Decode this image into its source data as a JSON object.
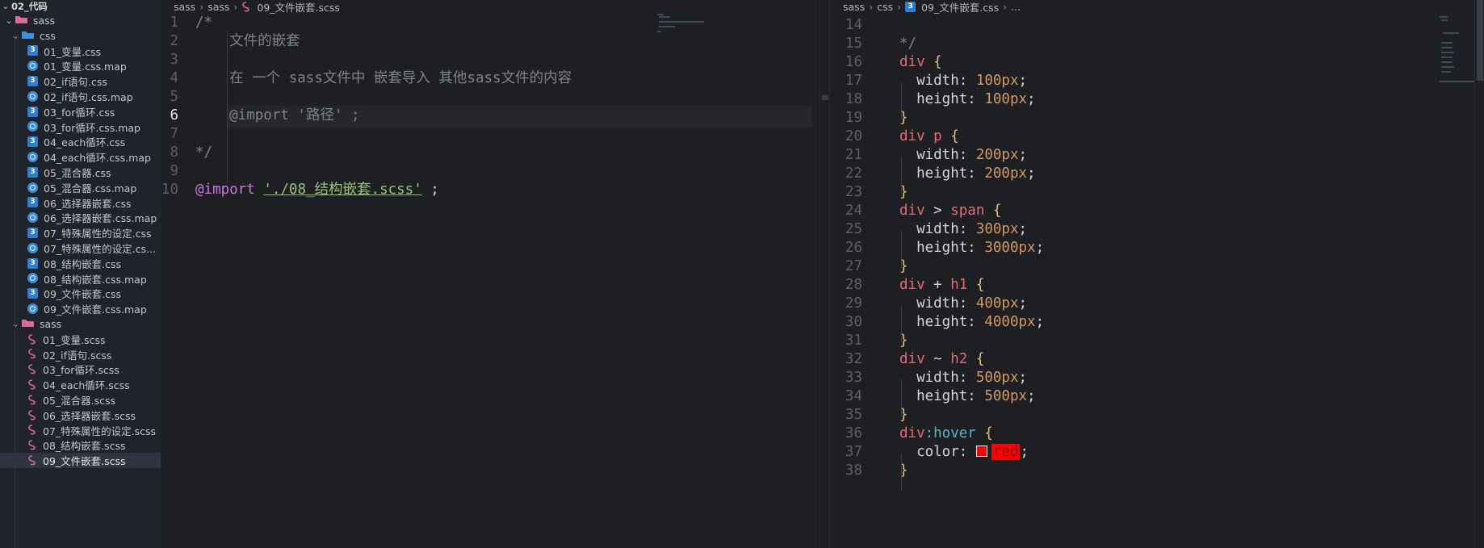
{
  "explorer": {
    "root": "02_代码",
    "items": [
      {
        "label": "sass",
        "type": "folder-sass",
        "depth": 0,
        "open": true
      },
      {
        "label": "css",
        "type": "folder-css",
        "depth": 1,
        "open": true
      },
      {
        "label": "01_变量.css",
        "type": "css",
        "depth": 2
      },
      {
        "label": "01_变量.css.map",
        "type": "map",
        "depth": 2
      },
      {
        "label": "02_if语句.css",
        "type": "css",
        "depth": 2
      },
      {
        "label": "02_if语句.css.map",
        "type": "map",
        "depth": 2
      },
      {
        "label": "03_for循环.css",
        "type": "css",
        "depth": 2
      },
      {
        "label": "03_for循环.css.map",
        "type": "map",
        "depth": 2
      },
      {
        "label": "04_each循环.css",
        "type": "css",
        "depth": 2
      },
      {
        "label": "04_each循环.css.map",
        "type": "map",
        "depth": 2
      },
      {
        "label": "05_混合器.css",
        "type": "css",
        "depth": 2
      },
      {
        "label": "05_混合器.css.map",
        "type": "map",
        "depth": 2
      },
      {
        "label": "06_选择器嵌套.css",
        "type": "css",
        "depth": 2
      },
      {
        "label": "06_选择器嵌套.css.map",
        "type": "map",
        "depth": 2
      },
      {
        "label": "07_特殊属性的设定.css",
        "type": "css",
        "depth": 2
      },
      {
        "label": "07_特殊属性的设定.cs...",
        "type": "map",
        "depth": 2
      },
      {
        "label": "08_结构嵌套.css",
        "type": "css",
        "depth": 2
      },
      {
        "label": "08_结构嵌套.css.map",
        "type": "map",
        "depth": 2
      },
      {
        "label": "09_文件嵌套.css",
        "type": "css",
        "depth": 2
      },
      {
        "label": "09_文件嵌套.css.map",
        "type": "map",
        "depth": 2
      },
      {
        "label": "sass",
        "type": "folder-sass",
        "depth": 1,
        "open": true
      },
      {
        "label": "01_变量.scss",
        "type": "scss",
        "depth": 2
      },
      {
        "label": "02_if语句.scss",
        "type": "scss",
        "depth": 2
      },
      {
        "label": "03_for循环.scss",
        "type": "scss",
        "depth": 2
      },
      {
        "label": "04_each循环.scss",
        "type": "scss",
        "depth": 2
      },
      {
        "label": "05_混合器.scss",
        "type": "scss",
        "depth": 2
      },
      {
        "label": "06_选择器嵌套.scss",
        "type": "scss",
        "depth": 2
      },
      {
        "label": "07_特殊属性的设定.scss",
        "type": "scss",
        "depth": 2
      },
      {
        "label": "08_结构嵌套.scss",
        "type": "scss",
        "depth": 2
      },
      {
        "label": "09_文件嵌套.scss",
        "type": "scss",
        "depth": 2,
        "active": true
      }
    ]
  },
  "left_editor": {
    "breadcrumb": [
      "sass",
      "sass",
      "09_文件嵌套.scss"
    ],
    "current_line": 6,
    "lines": [
      {
        "n": "1",
        "tokens": [
          [
            "cmt",
            "/*"
          ]
        ]
      },
      {
        "n": "2",
        "tokens": [
          [
            "cmt",
            "    文件的嵌套"
          ]
        ]
      },
      {
        "n": "3",
        "tokens": []
      },
      {
        "n": "4",
        "tokens": [
          [
            "cmt",
            "    在 一个 sass文件中 嵌套导入 其他sass文件的内容"
          ]
        ]
      },
      {
        "n": "5",
        "tokens": []
      },
      {
        "n": "6",
        "tokens": [
          [
            "cmt",
            "    @import '路径' ;"
          ]
        ]
      },
      {
        "n": "7",
        "tokens": []
      },
      {
        "n": "8",
        "tokens": [
          [
            "cmt",
            "*/"
          ]
        ]
      },
      {
        "n": "9",
        "tokens": []
      },
      {
        "n": "10",
        "tokens": [
          [
            "kw-at",
            "@import"
          ],
          [
            "punc",
            " "
          ],
          [
            "str",
            "'./08_结构嵌套.scss'"
          ],
          [
            "punc",
            " ;"
          ]
        ]
      }
    ]
  },
  "right_editor": {
    "breadcrumb": [
      "sass",
      "css",
      "09_文件嵌套.css",
      "..."
    ],
    "lines": [
      {
        "n": "14",
        "tokens": []
      },
      {
        "n": "15",
        "tokens": [
          [
            "cmt",
            "*/"
          ]
        ]
      },
      {
        "n": "16",
        "tokens": [
          [
            "sel",
            "div"
          ],
          [
            "punc",
            " "
          ],
          [
            "brace",
            "{"
          ]
        ]
      },
      {
        "n": "17",
        "tokens": [
          [
            "prop",
            "  width: "
          ],
          [
            "num",
            "100px"
          ],
          [
            "punc",
            ";"
          ]
        ]
      },
      {
        "n": "18",
        "tokens": [
          [
            "prop",
            "  height: "
          ],
          [
            "num",
            "100px"
          ],
          [
            "punc",
            ";"
          ]
        ]
      },
      {
        "n": "19",
        "tokens": [
          [
            "brace",
            "}"
          ]
        ]
      },
      {
        "n": "20",
        "tokens": [
          [
            "sel",
            "div p"
          ],
          [
            "punc",
            " "
          ],
          [
            "brace",
            "{"
          ]
        ]
      },
      {
        "n": "21",
        "tokens": [
          [
            "prop",
            "  width: "
          ],
          [
            "num",
            "200px"
          ],
          [
            "punc",
            ";"
          ]
        ]
      },
      {
        "n": "22",
        "tokens": [
          [
            "prop",
            "  height: "
          ],
          [
            "num",
            "200px"
          ],
          [
            "punc",
            ";"
          ]
        ]
      },
      {
        "n": "23",
        "tokens": [
          [
            "brace",
            "}"
          ]
        ]
      },
      {
        "n": "24",
        "tokens": [
          [
            "sel",
            "div"
          ],
          [
            "punc",
            " > "
          ],
          [
            "sel",
            "span"
          ],
          [
            "punc",
            " "
          ],
          [
            "brace",
            "{"
          ]
        ]
      },
      {
        "n": "25",
        "tokens": [
          [
            "prop",
            "  width: "
          ],
          [
            "num",
            "300px"
          ],
          [
            "punc",
            ";"
          ]
        ]
      },
      {
        "n": "26",
        "tokens": [
          [
            "prop",
            "  height: "
          ],
          [
            "num",
            "3000px"
          ],
          [
            "punc",
            ";"
          ]
        ]
      },
      {
        "n": "27",
        "tokens": [
          [
            "brace",
            "}"
          ]
        ]
      },
      {
        "n": "28",
        "tokens": [
          [
            "sel",
            "div"
          ],
          [
            "punc",
            " + "
          ],
          [
            "sel",
            "h1"
          ],
          [
            "punc",
            " "
          ],
          [
            "brace",
            "{"
          ]
        ]
      },
      {
        "n": "29",
        "tokens": [
          [
            "prop",
            "  width: "
          ],
          [
            "num",
            "400px"
          ],
          [
            "punc",
            ";"
          ]
        ]
      },
      {
        "n": "30",
        "tokens": [
          [
            "prop",
            "  height: "
          ],
          [
            "num",
            "4000px"
          ],
          [
            "punc",
            ";"
          ]
        ]
      },
      {
        "n": "31",
        "tokens": [
          [
            "brace",
            "}"
          ]
        ]
      },
      {
        "n": "32",
        "tokens": [
          [
            "sel",
            "div"
          ],
          [
            "punc",
            " ~ "
          ],
          [
            "sel",
            "h2"
          ],
          [
            "punc",
            " "
          ],
          [
            "brace",
            "{"
          ]
        ]
      },
      {
        "n": "33",
        "tokens": [
          [
            "prop",
            "  width: "
          ],
          [
            "num",
            "500px"
          ],
          [
            "punc",
            ";"
          ]
        ]
      },
      {
        "n": "34",
        "tokens": [
          [
            "prop",
            "  height: "
          ],
          [
            "num",
            "500px"
          ],
          [
            "punc",
            ";"
          ]
        ]
      },
      {
        "n": "35",
        "tokens": [
          [
            "brace",
            "}"
          ]
        ]
      },
      {
        "n": "36",
        "tokens": [
          [
            "sel",
            "div"
          ],
          [
            "pseudo",
            ":hover"
          ],
          [
            "punc",
            " "
          ],
          [
            "brace",
            "{"
          ]
        ]
      },
      {
        "n": "37",
        "tokens": [
          [
            "prop",
            "  color: "
          ],
          [
            "swatch",
            ""
          ],
          [
            "redkw",
            "red"
          ],
          [
            "punc",
            ";"
          ]
        ]
      },
      {
        "n": "38",
        "tokens": [
          [
            "brace",
            "}"
          ]
        ]
      }
    ]
  },
  "colors": {
    "accent_red": "#ff0000",
    "selector": "#e06c75",
    "number": "#d19a66",
    "string": "#98c379",
    "at_rule": "#c678dd"
  }
}
